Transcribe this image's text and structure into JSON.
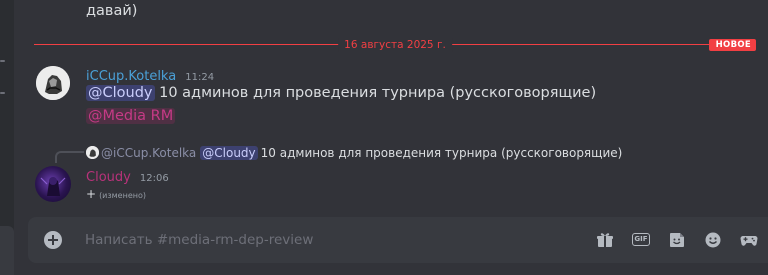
{
  "previous_message": {
    "text": "давай)"
  },
  "divider": {
    "date": "16 августа 2025 г.",
    "badge": "НОВОЕ"
  },
  "message1": {
    "username": "iCCup.Kotelka",
    "time": "11:24",
    "mention": "@Cloudy",
    "text": "10 админов для проведения турнира (русскоговорящие)",
    "role_mention": "@Media RM"
  },
  "message2": {
    "reply": {
      "username": "@iCCup.Kotelka",
      "mention": "@Cloudy",
      "text": "10 админов для проведения турнира (русскоговорящие)"
    },
    "username": "Cloudy",
    "time": "12:06",
    "text": "+",
    "edited": "(изменено)"
  },
  "composer": {
    "placeholder": "Написать #media-rm-dep-review",
    "gif_label": "GIF",
    "icons": [
      "add-icon",
      "gift-icon",
      "gif-icon",
      "sticker-icon",
      "emoji-icon",
      "activities-icon"
    ]
  },
  "colors": {
    "background": "#323339",
    "accent_red": "#f23f43",
    "username1": "#4aa0d7",
    "username2": "#b8327a",
    "mention_bg": "rgba(88,101,242,0.3)",
    "role_mention": "#c63a86"
  }
}
